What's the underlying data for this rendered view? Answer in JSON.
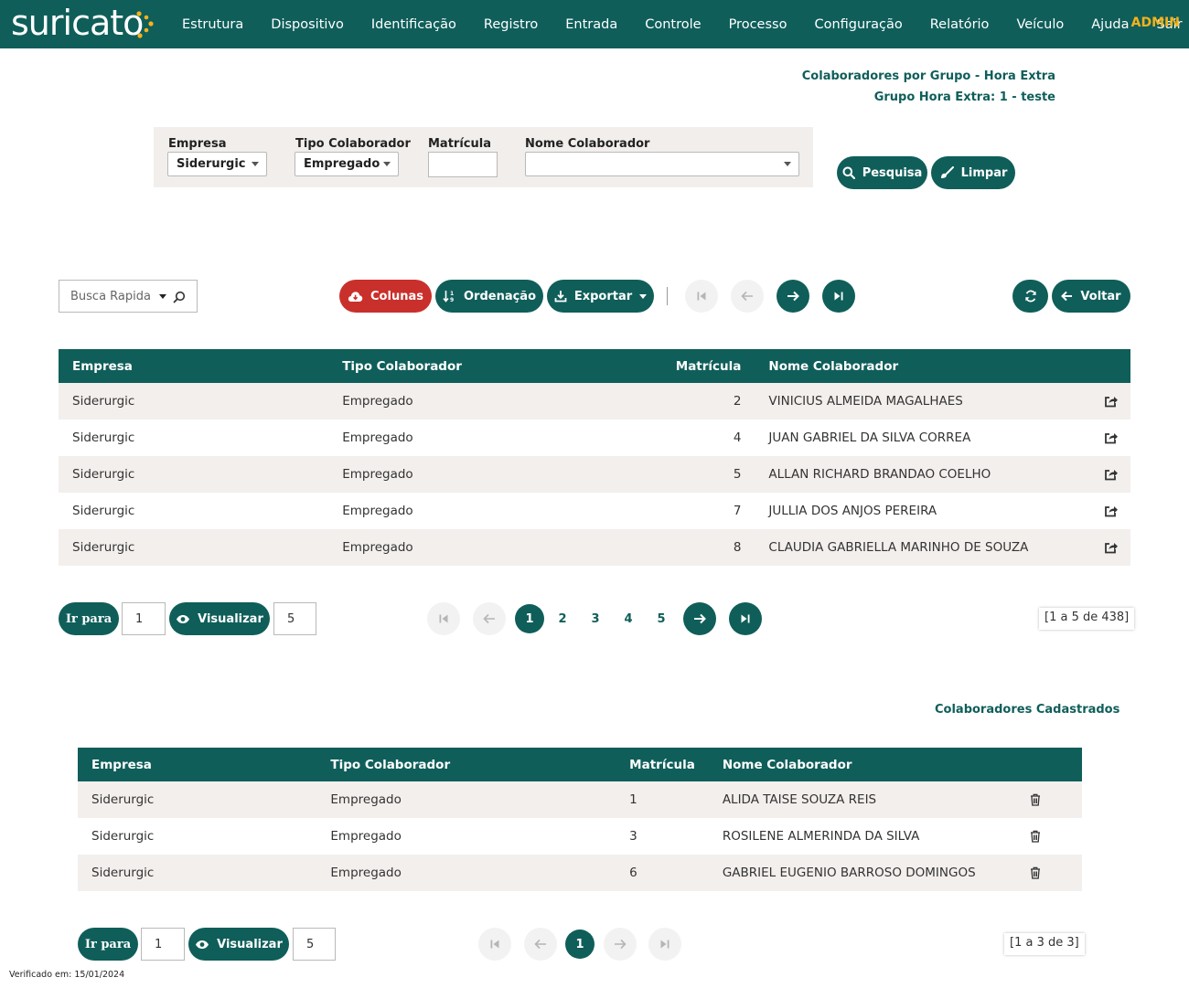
{
  "app": {
    "logo": "suricato",
    "menu": [
      "Estrutura",
      "Dispositivo",
      "Identificação",
      "Registro",
      "Entrada",
      "Controle",
      "Processo",
      "Configuração",
      "Relatório",
      "Veículo",
      "Ajuda",
      "Sair"
    ],
    "user": "ADMIN",
    "accent": "#0f5e5a",
    "user_color": "#f5b21b"
  },
  "header": {
    "title": "Colaboradores por Grupo - Hora Extra",
    "subtitle": "Grupo Hora Extra: 1 - teste"
  },
  "filters": {
    "empresa_label": "Empresa",
    "empresa_value": "Siderurgic",
    "tipo_label": "Tipo Colaborador",
    "tipo_value": "Empregado",
    "matricula_label": "Matrícula",
    "matricula_value": "",
    "nome_label": "Nome Colaborador",
    "nome_value": "",
    "search_button": "Pesquisa",
    "clear_button": "Limpar"
  },
  "toolbar": {
    "quick_search_placeholder": "Busca Rapida",
    "columns_button": "Colunas",
    "sort_button": "Ordenação",
    "export_button": "Exportar",
    "back_button": "Voltar",
    "columns_color": "#c9302c"
  },
  "table1": {
    "headers": [
      "Empresa",
      "Tipo Colaborador",
      "Matrícula",
      "Nome Colaborador"
    ],
    "rows": [
      [
        "Siderurgic",
        "Empregado",
        "2",
        "VINICIUS ALMEIDA MAGALHAES"
      ],
      [
        "Siderurgic",
        "Empregado",
        "4",
        "JUAN GABRIEL DA SILVA CORREA"
      ],
      [
        "Siderurgic",
        "Empregado",
        "5",
        "ALLAN RICHARD BRANDAO COELHO"
      ],
      [
        "Siderurgic",
        "Empregado",
        "7",
        "JULLIA DOS ANJOS PEREIRA"
      ],
      [
        "Siderurgic",
        "Empregado",
        "8",
        "CLAUDIA GABRIELLA MARINHO DE SOUZA"
      ]
    ],
    "row_icon": "external-link-icon"
  },
  "pager1": {
    "goto_label": "Ir para",
    "goto_value": "1",
    "view_label": "Visualizar",
    "view_value": "5",
    "pages": [
      "1",
      "2",
      "3",
      "4",
      "5"
    ],
    "active_page": "1",
    "count": "[1 a 5 de 438]"
  },
  "section2": {
    "title": "Colaboradores Cadastrados"
  },
  "table2": {
    "headers": [
      "Empresa",
      "Tipo Colaborador",
      "Matrícula",
      "Nome Colaborador"
    ],
    "rows": [
      [
        "Siderurgic",
        "Empregado",
        "1",
        "ALIDA TAISE SOUZA REIS"
      ],
      [
        "Siderurgic",
        "Empregado",
        "3",
        "ROSILENE ALMERINDA DA SILVA"
      ],
      [
        "Siderurgic",
        "Empregado",
        "6",
        "GABRIEL EUGENIO BARROSO DOMINGOS"
      ]
    ],
    "row_icon": "trash-icon"
  },
  "pager2": {
    "goto_label": "Ir para",
    "goto_value": "1",
    "view_label": "Visualizar",
    "view_value": "5",
    "pages": [
      "1"
    ],
    "active_page": "1",
    "count": "[1 a 3 de 3]"
  },
  "footer": {
    "verified": "Verificado em: 15/01/2024"
  }
}
